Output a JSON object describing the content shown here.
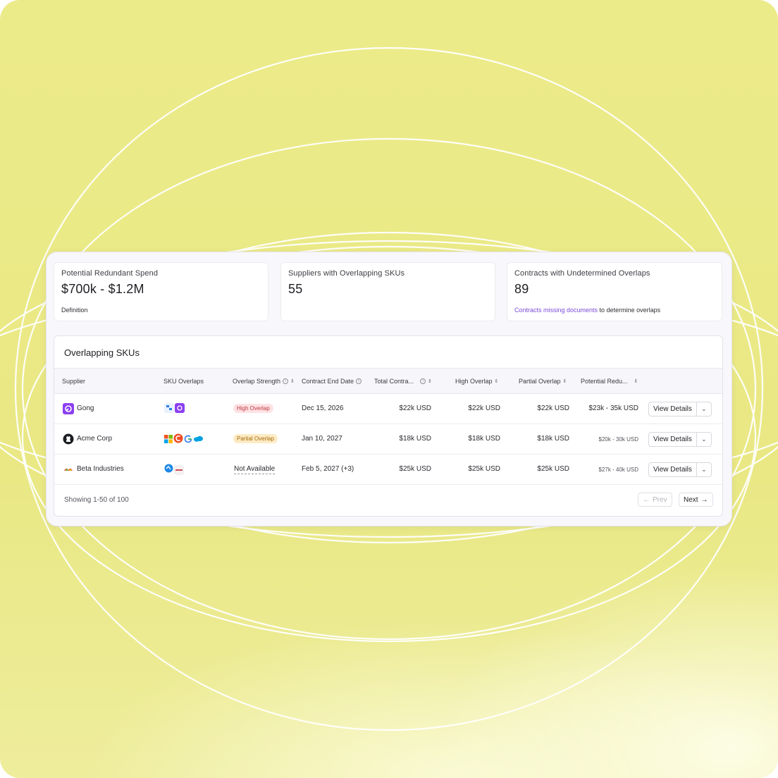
{
  "stats": [
    {
      "label": "Potential Redundant Spend",
      "value": "$700k - $1.2M",
      "foot": "Definition"
    },
    {
      "label": "Suppliers with Overlapping SKUs",
      "value": "55"
    },
    {
      "label": "Contracts with Undetermined Overlaps",
      "value": "89",
      "foot_link": "Contracts missing documents",
      "foot_rest": " to determine overlaps"
    }
  ],
  "table": {
    "title": "Overlapping SKUs",
    "columns": {
      "supplier": "Supplier",
      "sku_overlaps": "SKU Overlaps",
      "overlap_strength": "Overlap Strength",
      "contract_end": "Contract End Date",
      "total_contract": "Total Contra...",
      "high_overlap": "High Overlap",
      "partial_overlap": "Partial Overlap",
      "potential_redundant": "Potential Redu..."
    },
    "rows": [
      {
        "supplier": "Gong",
        "strength": "High Overlap",
        "end_date": "Dec 15, 2026",
        "total": "$22k USD",
        "high": "$22k USD",
        "partial": "$22k USD",
        "potential": "$23k - 35k USD",
        "action": "View Details"
      },
      {
        "supplier": "Acme Corp",
        "strength": "Partial Overlap",
        "end_date": "Jan 10, 2027",
        "total": "$18k USD",
        "high": "$18k USD",
        "partial": "$18k USD",
        "potential": "$20k - 30k USD",
        "action": "View Details"
      },
      {
        "supplier": "Beta Industries",
        "strength": "Not Available",
        "end_date": "Feb 5, 2027 (+3)",
        "total": "$25k USD",
        "high": "$25k USD",
        "partial": "$25k USD",
        "potential": "$27k - 40k USD",
        "action": "View Details"
      }
    ],
    "footer": "Showing 1-50 of 100",
    "prev_label": "Prev",
    "next_label": "Next"
  },
  "icons": {
    "info": "info-icon",
    "sort": "sort-icon",
    "caret": "chevron-down-icon",
    "prev_arrow": "arrow-left-icon",
    "next_arrow": "arrow-right-icon"
  },
  "colors": {
    "background": "#eceb8a",
    "accent_link": "#7a4bd8",
    "high_badge_bg": "#fde2e4",
    "high_badge_text": "#c0363f",
    "partial_badge_bg": "#fdebc4",
    "partial_badge_text": "#a56a0c"
  }
}
